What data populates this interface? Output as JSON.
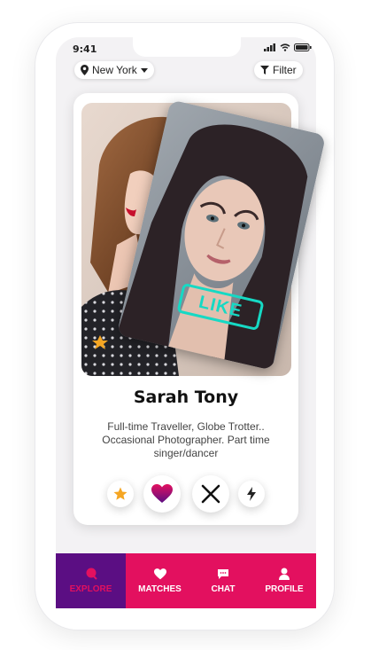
{
  "status": {
    "time": "9:41"
  },
  "header": {
    "location_label": "New York",
    "filter_label": "Filter"
  },
  "profile": {
    "name": "Sarah Tony",
    "bio": "Full-time Traveller, Globe Trotter.. Occasional Photographer. Part time singer/dancer",
    "swipe_label": "LIKE"
  },
  "actions": {
    "superlike": "star-icon",
    "like": "heart-icon",
    "dislike": "close-icon",
    "boost": "lightning-icon"
  },
  "nav": {
    "items": [
      {
        "label": "EXPLORE",
        "icon": "explore-icon",
        "active": true
      },
      {
        "label": "MATCHES",
        "icon": "heart-icon",
        "active": false
      },
      {
        "label": "CHAT",
        "icon": "chat-icon",
        "active": false
      },
      {
        "label": "PROFILE",
        "icon": "profile-icon",
        "active": false
      }
    ]
  },
  "colors": {
    "accent": "#e3105f",
    "active_tab": "#5b0e83",
    "like_stamp": "#16d9c4",
    "star": "#f5a623",
    "heart_top": "#e3105f",
    "heart_bottom": "#5b0e83"
  }
}
